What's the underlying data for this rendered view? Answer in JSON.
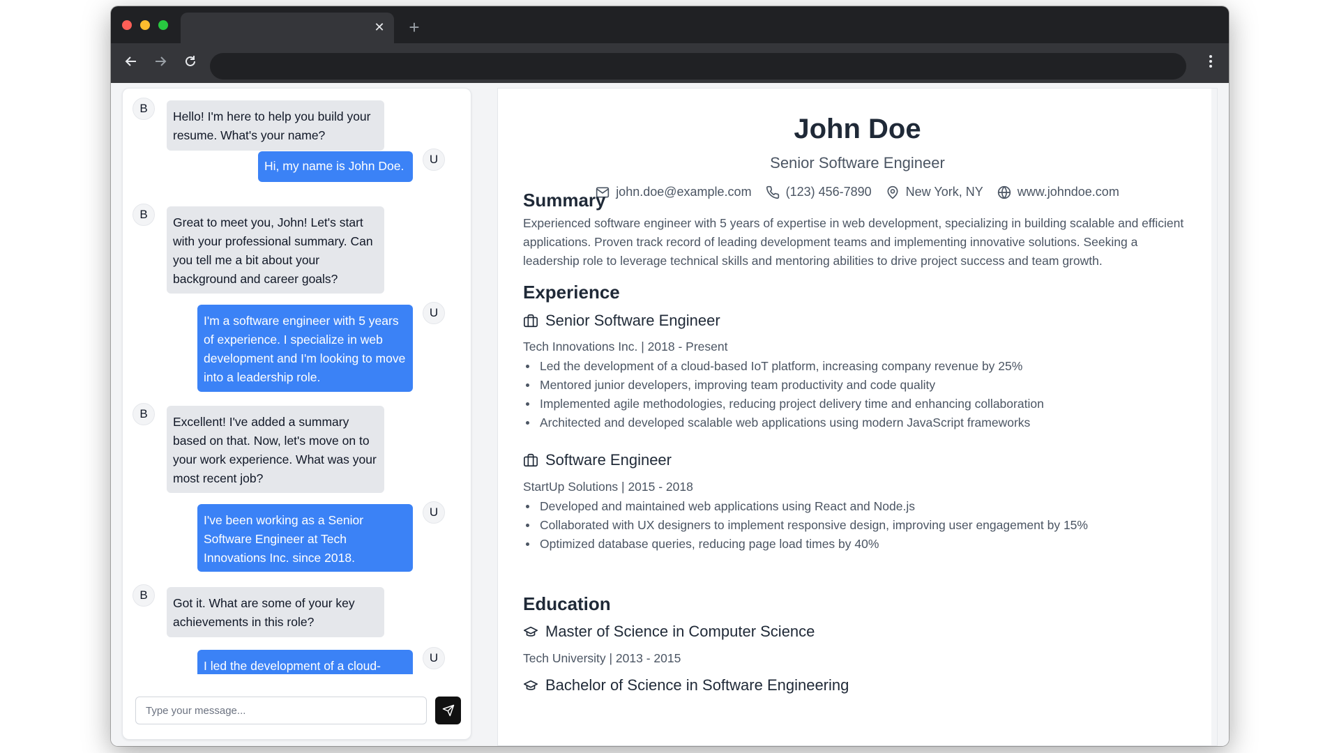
{
  "browser": {
    "tab_close": "✕",
    "new_tab": "+"
  },
  "chat": {
    "bot_avatar": "B",
    "user_avatar": "U",
    "messages": [
      {
        "role": "bot",
        "text": "Hello! I'm here to help you build your resume. What's your name?"
      },
      {
        "role": "user",
        "text": "Hi, my name is John Doe."
      },
      {
        "role": "bot",
        "text": "Great to meet you, John! Let's start with your professional summary. Can you tell me a bit about your background and career goals?"
      },
      {
        "role": "user",
        "text": "I'm a software engineer with 5 years of experience. I specialize in web development and I'm looking to move into a leadership role."
      },
      {
        "role": "bot",
        "text": "Excellent! I've added a summary based on that. Now, let's move on to your work experience. What was your most recent job?"
      },
      {
        "role": "user",
        "text": "I've been working as a Senior Software Engineer at Tech Innovations Inc. since 2018."
      },
      {
        "role": "bot",
        "text": "Got it. What are some of your key achievements in this role?"
      },
      {
        "role": "user",
        "text": "I led the development of a cloud-"
      }
    ],
    "input_placeholder": "Type your message..."
  },
  "resume": {
    "name": "John Doe",
    "title": "Senior Software Engineer",
    "contacts": {
      "email": "john.doe@example.com",
      "phone": "(123) 456-7890",
      "location": "New York, NY",
      "website": "www.johndoe.com"
    },
    "summary_heading": "Summary",
    "summary": "Experienced software engineer with 5 years of expertise in web development, specializing in building scalable and efficient applications. Proven track record of leading development teams and implementing innovative solutions. Seeking a leadership role to leverage technical skills and mentoring abilities to drive project success and team growth.",
    "experience_heading": "Experience",
    "jobs": [
      {
        "title": "Senior Software Engineer",
        "meta": "Tech Innovations Inc. | 2018 - Present",
        "bullets": [
          "Led the development of a cloud-based IoT platform, increasing company revenue by 25%",
          "Mentored junior developers, improving team productivity and code quality",
          "Implemented agile methodologies, reducing project delivery time and enhancing collaboration",
          "Architected and developed scalable web applications using modern JavaScript frameworks"
        ]
      },
      {
        "title": "Software Engineer",
        "meta": "StartUp Solutions | 2015 - 2018",
        "bullets": [
          "Developed and maintained web applications using React and Node.js",
          "Collaborated with UX designers to implement responsive design, improving user engagement by 15%",
          "Optimized database queries, reducing page load times by 40%"
        ]
      }
    ],
    "education_heading": "Education",
    "education": [
      {
        "degree": "Master of Science in Computer Science",
        "meta": "Tech University | 2013 - 2015"
      },
      {
        "degree": "Bachelor of Science in Software Engineering"
      }
    ]
  }
}
